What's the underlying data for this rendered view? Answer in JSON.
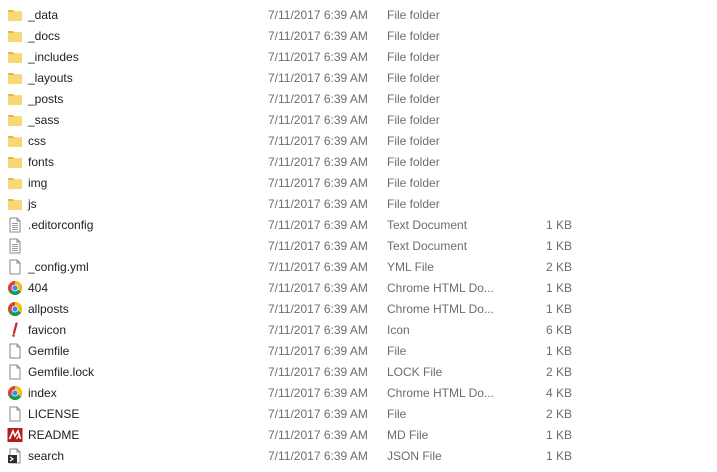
{
  "colors": {
    "folder": "#f8d775",
    "folder_dark": "#e8b83e",
    "chrome_red": "#db4437",
    "chrome_yellow": "#f4c20d",
    "chrome_green": "#0f9d58",
    "chrome_blue": "#4285f4",
    "text_primary": "#1e1e1e",
    "text_secondary": "#6d6d6d"
  },
  "files": [
    {
      "name": "_data",
      "date": "7/11/2017 6:39 AM",
      "type": "File folder",
      "size": "",
      "icon": "folder-icon"
    },
    {
      "name": "_docs",
      "date": "7/11/2017 6:39 AM",
      "type": "File folder",
      "size": "",
      "icon": "folder-icon"
    },
    {
      "name": "_includes",
      "date": "7/11/2017 6:39 AM",
      "type": "File folder",
      "size": "",
      "icon": "folder-icon"
    },
    {
      "name": "_layouts",
      "date": "7/11/2017 6:39 AM",
      "type": "File folder",
      "size": "",
      "icon": "folder-icon"
    },
    {
      "name": "_posts",
      "date": "7/11/2017 6:39 AM",
      "type": "File folder",
      "size": "",
      "icon": "folder-icon"
    },
    {
      "name": "_sass",
      "date": "7/11/2017 6:39 AM",
      "type": "File folder",
      "size": "",
      "icon": "folder-icon"
    },
    {
      "name": "css",
      "date": "7/11/2017 6:39 AM",
      "type": "File folder",
      "size": "",
      "icon": "folder-icon"
    },
    {
      "name": "fonts",
      "date": "7/11/2017 6:39 AM",
      "type": "File folder",
      "size": "",
      "icon": "folder-icon"
    },
    {
      "name": "img",
      "date": "7/11/2017 6:39 AM",
      "type": "File folder",
      "size": "",
      "icon": "folder-icon"
    },
    {
      "name": "js",
      "date": "7/11/2017 6:39 AM",
      "type": "File folder",
      "size": "",
      "icon": "folder-icon"
    },
    {
      "name": ".editorconfig",
      "date": "7/11/2017 6:39 AM",
      "type": "Text Document",
      "size": "1 KB",
      "icon": "text-document-icon"
    },
    {
      "name": "",
      "date": "7/11/2017 6:39 AM",
      "type": "Text Document",
      "size": "1 KB",
      "icon": "text-document-icon"
    },
    {
      "name": "_config.yml",
      "date": "7/11/2017 6:39 AM",
      "type": "YML File",
      "size": "2 KB",
      "icon": "blank-file-icon"
    },
    {
      "name": "404",
      "date": "7/11/2017 6:39 AM",
      "type": "Chrome HTML Do...",
      "size": "1 KB",
      "icon": "chrome-icon"
    },
    {
      "name": "allposts",
      "date": "7/11/2017 6:39 AM",
      "type": "Chrome HTML Do...",
      "size": "1 KB",
      "icon": "chrome-icon"
    },
    {
      "name": "favicon",
      "date": "7/11/2017 6:39 AM",
      "type": "Icon",
      "size": "6 KB",
      "icon": "icon-file-icon"
    },
    {
      "name": "Gemfile",
      "date": "7/11/2017 6:39 AM",
      "type": "File",
      "size": "1 KB",
      "icon": "blank-file-icon"
    },
    {
      "name": "Gemfile.lock",
      "date": "7/11/2017 6:39 AM",
      "type": "LOCK File",
      "size": "2 KB",
      "icon": "blank-file-icon"
    },
    {
      "name": "index",
      "date": "7/11/2017 6:39 AM",
      "type": "Chrome HTML Do...",
      "size": "4 KB",
      "icon": "chrome-icon"
    },
    {
      "name": "LICENSE",
      "date": "7/11/2017 6:39 AM",
      "type": "File",
      "size": "2 KB",
      "icon": "blank-file-icon"
    },
    {
      "name": "README",
      "date": "7/11/2017 6:39 AM",
      "type": "MD File",
      "size": "1 KB",
      "icon": "markdown-icon"
    },
    {
      "name": "search",
      "date": "7/11/2017 6:39 AM",
      "type": "JSON File",
      "size": "1 KB",
      "icon": "json-file-icon"
    }
  ]
}
